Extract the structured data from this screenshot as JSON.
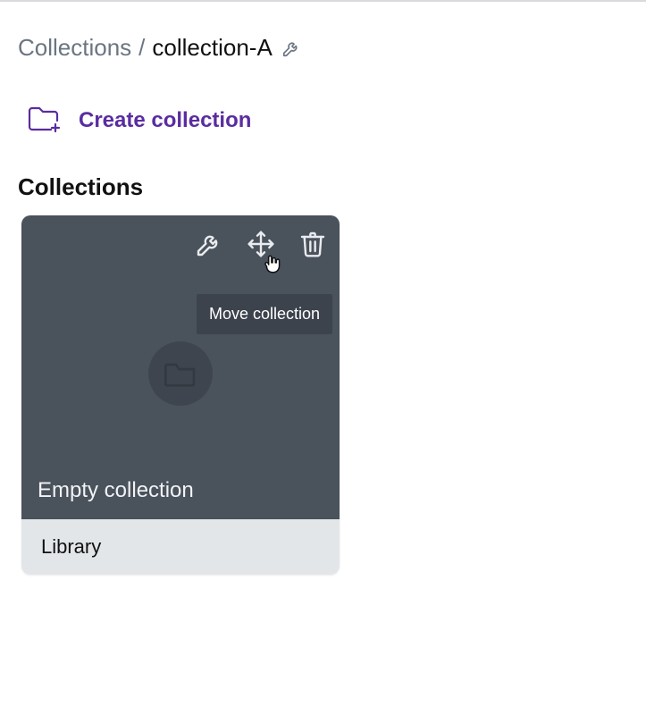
{
  "breadcrumb": {
    "root": "Collections",
    "separator": "/",
    "current": "collection-A"
  },
  "create": {
    "label": "Create collection"
  },
  "section": {
    "title": "Collections"
  },
  "tooltip": {
    "move": "Move collection"
  },
  "card": {
    "status": "Empty collection",
    "name": "Library"
  },
  "colors": {
    "accent": "#5a2ca0",
    "card_bg": "#4a525c",
    "card_footer": "#e3e6e9",
    "muted": "#6b7582"
  }
}
